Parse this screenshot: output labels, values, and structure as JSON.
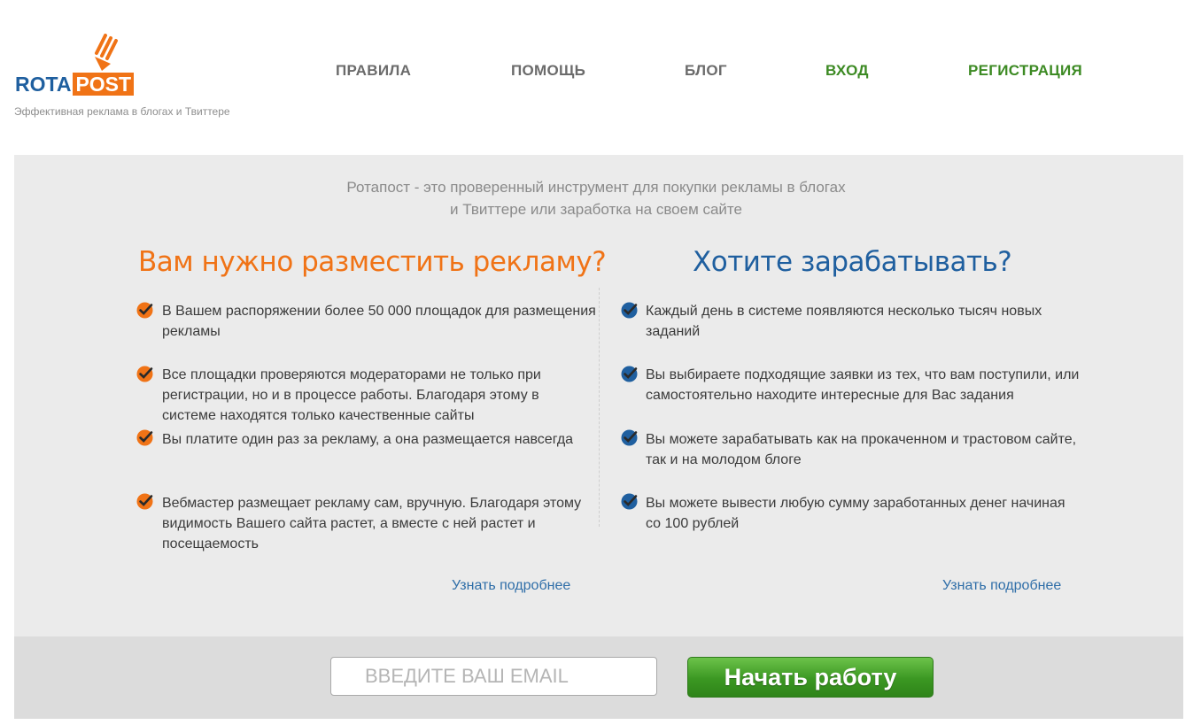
{
  "brand": {
    "logo_part1": "ROTA",
    "logo_part2": "POST",
    "tagline": "Эффективная реклама в блогах и Твиттере",
    "colors": {
      "blue": "#1f5f9f",
      "orange": "#f07316",
      "green": "#3c8a23"
    }
  },
  "nav": {
    "rules": "ПРАВИЛА",
    "help": "ПОМОЩЬ",
    "blog": "БЛОГ",
    "login": "ВХОД",
    "register": "РЕГИСТРАЦИЯ"
  },
  "intro": {
    "line1": "Ротапост - это проверенный инструмент для покупки рекламы в блогах",
    "line2": "и Твиттере или заработка на своем сайте"
  },
  "advertiser": {
    "title": "Вам нужно разместить рекламу?",
    "items": [
      "В Вашем распоряжении более 50 000 площадок для размещения рекламы",
      "Все площадки проверяются модераторами не только при регистрации, но и в процессе работы. Благодаря этому в системе находятся только качественные сайты",
      "Вы платите один раз за рекламу, а она размещается навсегда",
      "Вебмастер размещает рекламу сам, вручную. Благодаря этому видимость Вашего сайта растет, а вместе с ней растет и посещаемость"
    ],
    "more": "Узнать подробнее",
    "check_icon": "orange-check-icon"
  },
  "publisher": {
    "title": "Хотите зарабатывать?",
    "items": [
      "Каждый день в системе появляются несколько тысяч новых заданий",
      "Вы выбираете подходящие заявки из тех, что вам поступили, или самостоятельно находите интересные для Вас задания",
      "Вы можете зарабатывать как на прокаченном и трастовом сайте, так и на молодом блоге",
      "Вы можете вывести любую сумму заработанных денег начиная со 100 рублей"
    ],
    "more": "Узнать подробнее",
    "check_icon": "blue-check-icon"
  },
  "signup": {
    "email_placeholder": "ВВЕДИТЕ ВАШ EMAIL",
    "email_value": "",
    "button_label": "Начать работу"
  }
}
